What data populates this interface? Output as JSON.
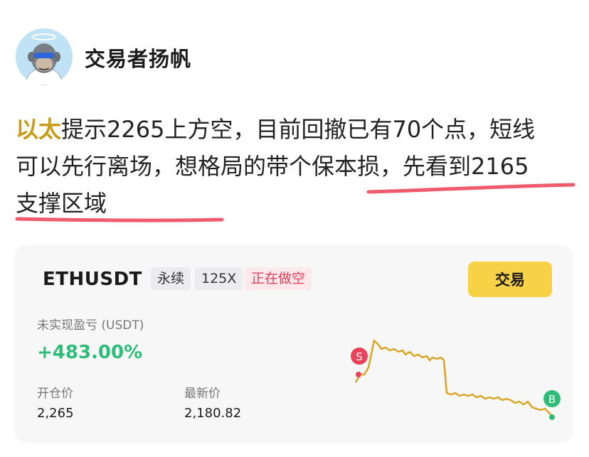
{
  "author": {
    "name": "交易者扬帆",
    "avatar_icon": "ape-avatar-icon"
  },
  "post": {
    "highlight": "以太",
    "line1_rest": "提示2265上方空，目前回撤已有70个点，短线",
    "line2": "可以先行离场，想格局的带个保本损，先看到2165",
    "line3": "支撑区域",
    "highlight_color": "#c89c16",
    "underline_color": "#ef5a6c"
  },
  "card": {
    "symbol": "ETHUSDT",
    "tags": {
      "perpetual": "永续",
      "leverage": "125X",
      "status": "正在做空"
    },
    "trade_button": "交易",
    "pnl_label": "未实现盈亏 (USDT)",
    "pnl_value": "+483.00%",
    "open_price_label": "开仓价",
    "open_price": "2,265",
    "last_price_label": "最新价",
    "last_price": "2,180.82",
    "sell_marker": "S",
    "buy_marker": "B",
    "colors": {
      "profit": "#2ebd79",
      "sell": "#e9425a",
      "line": "#d9a520",
      "button": "#f7d247"
    }
  }
}
